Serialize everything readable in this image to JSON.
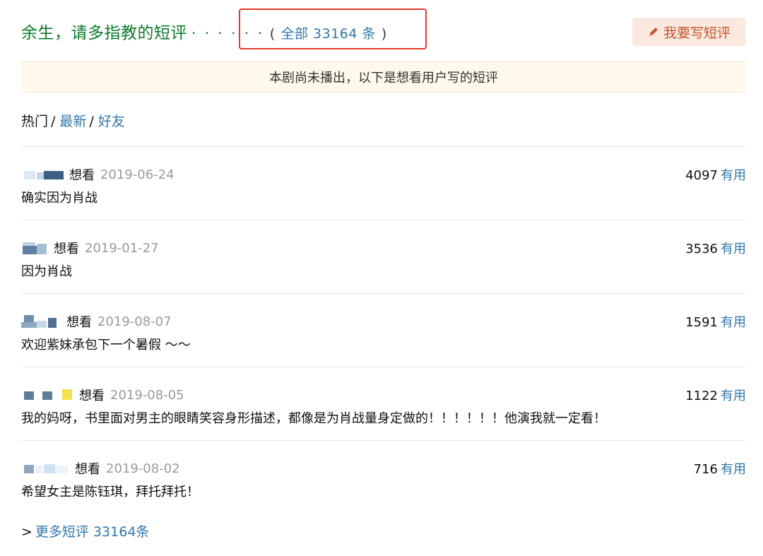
{
  "header": {
    "title": "余生，请多指教的短评",
    "dots": "· · · · · ·",
    "paren_open": "(",
    "total_label": "全部 33164 条",
    "paren_close": ")",
    "write_button": "我要写短评"
  },
  "notice": "本剧尚未播出，以下是想看用户写的短评",
  "sort_tabs": {
    "hot": "热门",
    "newest": "最新",
    "friends": "好友",
    "sep": "/"
  },
  "comments": [
    {
      "status": "想看",
      "date": "2019-06-24",
      "text": "确实因为肖战",
      "votes": "4097",
      "useful": "有用"
    },
    {
      "status": "想看",
      "date": "2019-01-27",
      "text": "因为肖战",
      "votes": "3536",
      "useful": "有用"
    },
    {
      "status": "想看",
      "date": "2019-08-07",
      "text": "欢迎紫妹承包下一个暑假 ～～",
      "votes": "1591",
      "useful": "有用"
    },
    {
      "status": "想看",
      "date": "2019-08-05",
      "text": "我的妈呀，书里面对男主的眼睛笑容身形描述，都像是为肖战量身定做的！！！！！！他演我就一定看！",
      "votes": "1122",
      "useful": "有用"
    },
    {
      "status": "想看",
      "date": "2019-08-02",
      "text": "希望女主是陈钰琪，拜托拜托！",
      "votes": "716",
      "useful": "有用"
    }
  ],
  "more": {
    "arrow": ">",
    "label": "更多短评 33164条"
  },
  "colors": {
    "title_green": "#0a7a2b",
    "link_blue": "#3377aa",
    "highlight_red": "#e33a2c",
    "button_bg": "#fbe9df",
    "button_text": "#c4542e",
    "notice_bg": "#fff9ec",
    "date_gray": "#9a9a9a"
  },
  "icons": {
    "write_button": "pencil-icon",
    "username": "blurred-username-icon"
  }
}
